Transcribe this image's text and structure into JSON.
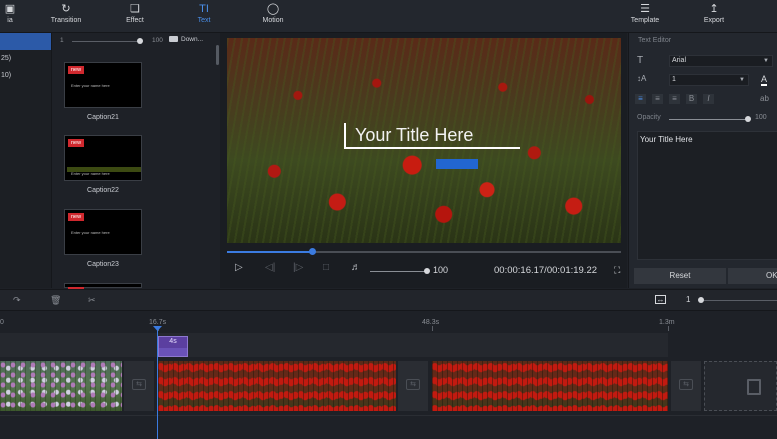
{
  "toolbar": {
    "items": [
      {
        "label": "ia",
        "icon": "media-icon"
      },
      {
        "label": "Transition",
        "icon": "transition-icon"
      },
      {
        "label": "Effect",
        "icon": "effect-icon"
      },
      {
        "label": "Text",
        "icon": "text-icon",
        "active": true
      },
      {
        "label": "Motion",
        "icon": "motion-icon"
      },
      {
        "label": "Template",
        "icon": "template-icon"
      },
      {
        "label": "Export",
        "icon": "export-icon"
      }
    ]
  },
  "left_list": {
    "items": [
      {
        "label": "",
        "selected": true
      },
      {
        "label": "25)"
      },
      {
        "label": "10)"
      }
    ]
  },
  "library": {
    "size_min": "1",
    "size_max": "100",
    "download_label": "Down...",
    "captions": [
      {
        "name": "Caption21",
        "badge": "new",
        "preview_text": "Enter your name here"
      },
      {
        "name": "Caption22",
        "badge": "new",
        "preview_text": "Enter your name here"
      },
      {
        "name": "Caption23",
        "badge": "new",
        "preview_text": "Enter your name here"
      },
      {
        "name": "",
        "badge": "new",
        "preview_text": ""
      }
    ]
  },
  "preview": {
    "overlay_title": "Your Title Here",
    "progress_fraction": 0.215,
    "volume": "100",
    "time_current": "00:00:16.17",
    "time_total": "00:01:19.22",
    "timecode": "00:00:16.17/00:01:19.22"
  },
  "text_editor": {
    "header": "Text Editor",
    "font": "Arial",
    "font_size": "1",
    "opacity_label": "Opacity",
    "opacity_value": "100",
    "text_value": "Your Title Here",
    "reset_label": "Reset",
    "ok_label": "OK",
    "accent_color": "#4a8ee8"
  },
  "timeline_toolbar": {
    "zoom_value": "1"
  },
  "timeline": {
    "ruler_labels": [
      "0",
      "16.7s",
      "48.3s",
      "1.3m"
    ],
    "title_clip_label": "4s",
    "playhead_color": "#3b7be0",
    "title_clip_color": "#5b3fa0"
  }
}
